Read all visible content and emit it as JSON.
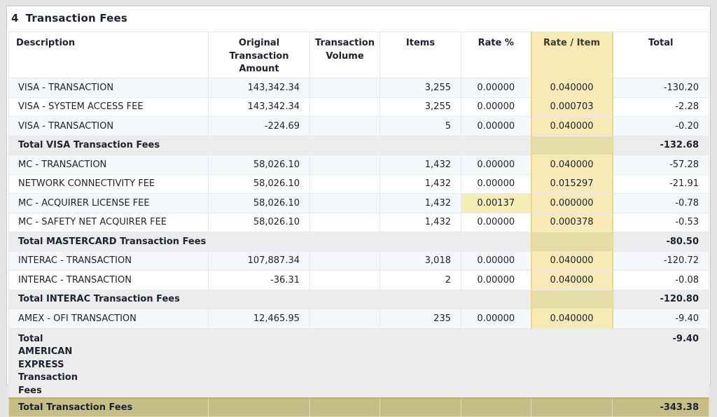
{
  "section": {
    "number": "4",
    "title": "Transaction Fees"
  },
  "headers": {
    "description": "Description",
    "original_line1": "Original",
    "original_line2": "Transaction",
    "original_line3": "Amount",
    "volume_line1": "Transaction",
    "volume_line2": "Volume",
    "items": "Items",
    "rate_pct": "Rate %",
    "rate_item": "Rate / Item",
    "total": "Total"
  },
  "rows": [
    {
      "description": "VISA - TRANSACTION",
      "amount": "143,342.34",
      "volume": "",
      "items": "3,255",
      "rate_pct": "0.00000",
      "rate_item": "0.040000",
      "total": "-130.20"
    },
    {
      "description": "VISA - SYSTEM ACCESS FEE",
      "amount": "143,342.34",
      "volume": "",
      "items": "3,255",
      "rate_pct": "0.00000",
      "rate_item": "0.000703",
      "total": "-2.28"
    },
    {
      "description": "VISA - TRANSACTION",
      "amount": "-224.69",
      "volume": "",
      "items": "5",
      "rate_pct": "0.00000",
      "rate_item": "0.040000",
      "total": "-0.20"
    },
    {
      "subtotal_label": "Total VISA Transaction Fees",
      "subtotal": "-132.68"
    },
    {
      "description": "MC - TRANSACTION",
      "amount": "58,026.10",
      "volume": "",
      "items": "1,432",
      "rate_pct": "0.00000",
      "rate_item": "0.040000",
      "total": "-57.28"
    },
    {
      "description": "NETWORK CONNECTIVITY FEE",
      "amount": "58,026.10",
      "volume": "",
      "items": "1,432",
      "rate_pct": "0.00000",
      "rate_item": "0.015297",
      "total": "-21.91"
    },
    {
      "description": "MC - ACQUIRER LICENSE FEE",
      "amount": "58,026.10",
      "volume": "",
      "items": "1,432",
      "rate_pct": "0.00137",
      "rate_item": "0.000000",
      "total": "-0.78"
    },
    {
      "description": "MC - SAFETY NET ACQUIRER FEE",
      "amount": "58,026.10",
      "volume": "",
      "items": "1,432",
      "rate_pct": "0.00000",
      "rate_item": "0.000378",
      "total": "-0.53"
    },
    {
      "subtotal_label": "Total MASTERCARD Transaction Fees",
      "subtotal": "-80.50"
    },
    {
      "description": "INTERAC - TRANSACTION",
      "amount": "107,887.34",
      "volume": "",
      "items": "3,018",
      "rate_pct": "0.00000",
      "rate_item": "0.040000",
      "total": "-120.72"
    },
    {
      "description": "INTERAC - TRANSACTION",
      "amount": "-36.31",
      "volume": "",
      "items": "2",
      "rate_pct": "0.00000",
      "rate_item": "0.040000",
      "total": "-0.08"
    },
    {
      "subtotal_label": "Total INTERAC Transaction Fees",
      "subtotal": "-120.80"
    },
    {
      "description": "AMEX - OFI TRANSACTION",
      "amount": "12,465.95",
      "volume": "",
      "items": "235",
      "rate_pct": "0.00000",
      "rate_item": "0.040000",
      "total": "-9.40"
    },
    {
      "subtotal_label": "Total AMERICAN EXPRESS Transaction Fees",
      "subtotal": "-9.40"
    }
  ],
  "grand_total": {
    "label": "Total Transaction Fees",
    "value": "-343.38"
  }
}
